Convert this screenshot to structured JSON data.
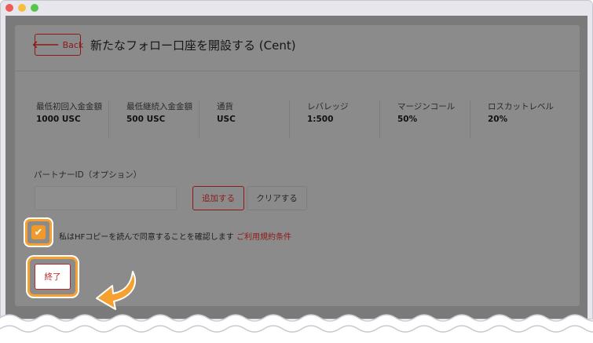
{
  "window": {
    "controls": [
      "close",
      "minimize",
      "maximize"
    ]
  },
  "header": {
    "back_label": "Back",
    "title": "新たなフォロー口座を開設する (Cent)"
  },
  "account_info": [
    {
      "label": "最低初回入金金額",
      "value": "1000 USC"
    },
    {
      "label": "最低継続入金金額",
      "value": "500 USC"
    },
    {
      "label": "通貨",
      "value": "USC"
    },
    {
      "label": "レバレッジ",
      "value": "1:500"
    },
    {
      "label": "マージンコール",
      "value": "50%"
    },
    {
      "label": "ロスカットレベル",
      "value": "20%"
    }
  ],
  "partner": {
    "label": "パートナーID（オプション）",
    "input_value": "",
    "add_label": "追加する",
    "clear_label": "クリアする"
  },
  "agreement": {
    "checked": true,
    "text": "私はHFコピーを読んで同意することを確認します",
    "link_text": "ご利用規約条件"
  },
  "finish_label": "終了",
  "colors": {
    "accent": "#8e1a1a",
    "highlight": "#f6a030",
    "overlay": "#7a7a7a"
  },
  "icons": [
    "back-arrow-icon",
    "checkmark-icon",
    "pointer-arrow-icon"
  ]
}
